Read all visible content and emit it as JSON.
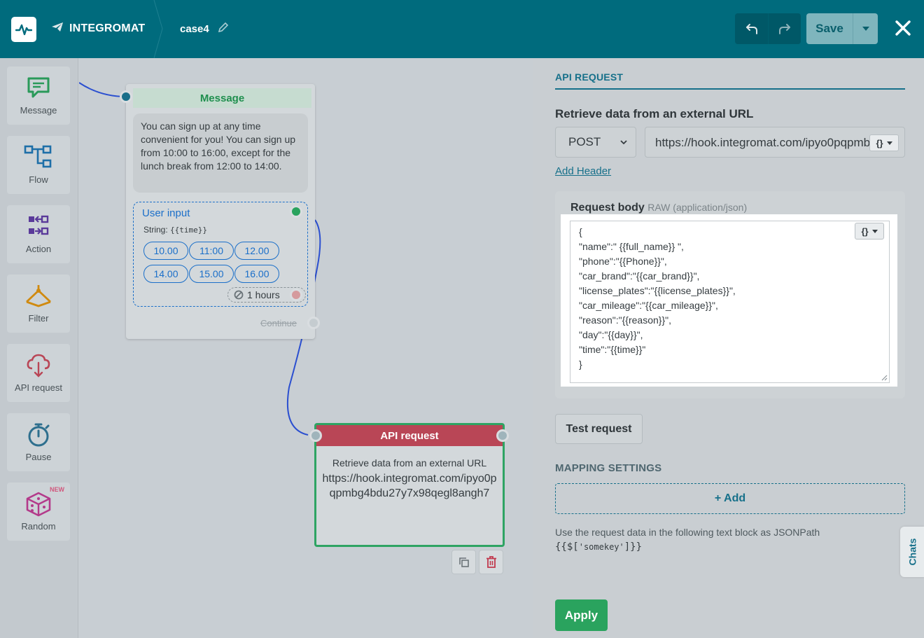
{
  "header": {
    "brand": "INTEGROMAT",
    "project_name": "case4",
    "save_label": "Save",
    "icons": {
      "logo": "pulse-icon",
      "brand": "paper-plane-icon",
      "edit": "pencil-icon",
      "undo": "undo-icon",
      "redo": "redo-icon",
      "save_menu": "caret-down-icon",
      "close": "close-icon"
    }
  },
  "sidebar": {
    "items": [
      {
        "label": "Message",
        "icon": "message-icon",
        "color": "#2a9a5a"
      },
      {
        "label": "Flow",
        "icon": "flow-icon",
        "color": "#1e6fa8"
      },
      {
        "label": "Action",
        "icon": "action-icon",
        "color": "#5a3a9a"
      },
      {
        "label": "Filter",
        "icon": "filter-icon",
        "color": "#d08a10"
      },
      {
        "label": "API request",
        "icon": "cloud-icon",
        "color": "#b94656"
      },
      {
        "label": "Pause",
        "icon": "stopwatch-icon",
        "color": "#2e6f8e"
      },
      {
        "label": "Random",
        "icon": "dice-icon",
        "color": "#b33a8a",
        "badge": "NEW"
      }
    ]
  },
  "canvas": {
    "message_node": {
      "title": "Message",
      "text": "You can sign up at any time convenient for you! You can sign up from 10:00 to 16:00, except for the lunch break from 12:00 to 14:00.",
      "user_input": {
        "title": "User input",
        "type_label": "String:",
        "type_var": "{{time}}",
        "options": [
          "10.00",
          "11:00",
          "12.00",
          "14.00",
          "15.00",
          "16.00"
        ],
        "timeout": "1 hours"
      },
      "continue_label": "Continue"
    },
    "api_node": {
      "title": "API request",
      "description": "Retrieve data from an external URL",
      "url": "https://hook.integromat.com/ipyo0pqpmbg4bdu27y7x98qegl8angh7"
    }
  },
  "panel": {
    "title": "API REQUEST",
    "section_label": "Retrieve data from an external URL",
    "method": "POST",
    "url": "https://hook.integromat.com/ipyo0pqpmbg4bdu27y7x98qegl8angh7",
    "add_header": "Add Header",
    "request_body": {
      "label": "Request body",
      "format": "RAW (application/json)",
      "content": "{\n\"name\":\" {{full_name}} \",\n\"phone\":\"{{Phone}}\",\n\"car_brand\":\"{{car_brand}}\",\n\"license_plates\":\"{{license_plates}}\",\n\"car_mileage\":\"{{car_mileage}}\",\n\"reason\":\"{{reason}}\",\n\"day\":\"{{day}}\",\n\"time\":\"{{time}}\"\n}"
    },
    "test_request": "Test request",
    "mapping_title": "MAPPING SETTINGS",
    "add_mapping": "+ Add",
    "hint": "Use the request data in the following text block as JSONPath",
    "hint_code": {
      "open": "{{$[",
      "key": "'somekey'",
      "close": "]}}"
    },
    "apply": "Apply",
    "var_button": "{}"
  },
  "chats_tab": "Chats",
  "colors": {
    "header": "#006b7d",
    "accent": "#16708a",
    "success": "#2aa35e",
    "api_red": "#b94656",
    "input_blue": "#1b6fc9"
  }
}
